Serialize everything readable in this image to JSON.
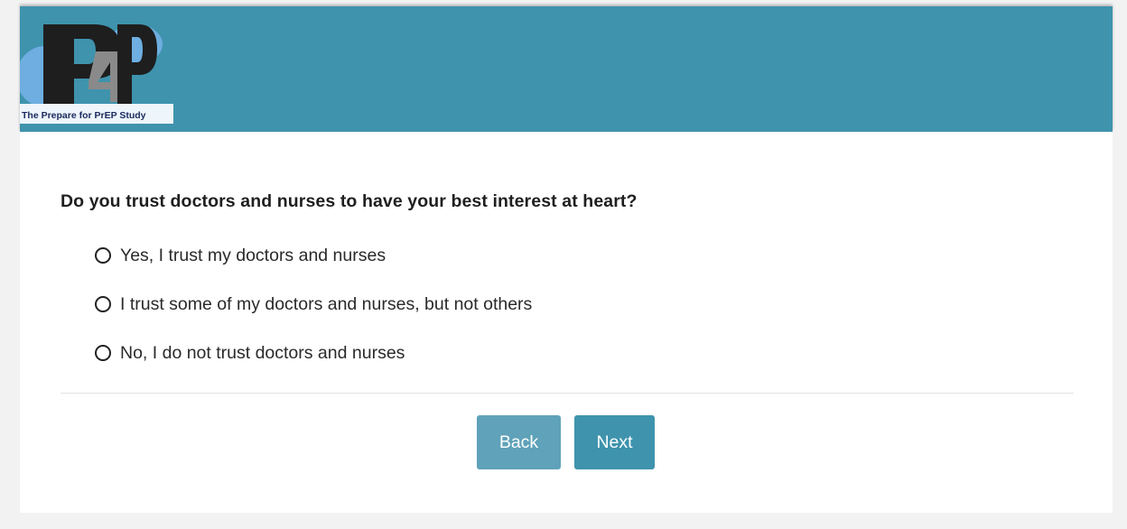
{
  "header": {
    "logo_text": "P4P",
    "logo_tagline": "The Prepare for PrEP Study",
    "color": "#3f93ad"
  },
  "question": {
    "text": "Do you trust doctors and nurses to have your best interest at heart?",
    "options": [
      {
        "label": "Yes, I trust my doctors and nurses",
        "selected": false
      },
      {
        "label": "I trust some of my doctors and nurses, but not others",
        "selected": false
      },
      {
        "label": "No, I do not trust doctors and nurses",
        "selected": false
      }
    ]
  },
  "nav": {
    "back_label": "Back",
    "next_label": "Next",
    "back_color": "#5fa2b9",
    "next_color": "#3f93ad"
  }
}
